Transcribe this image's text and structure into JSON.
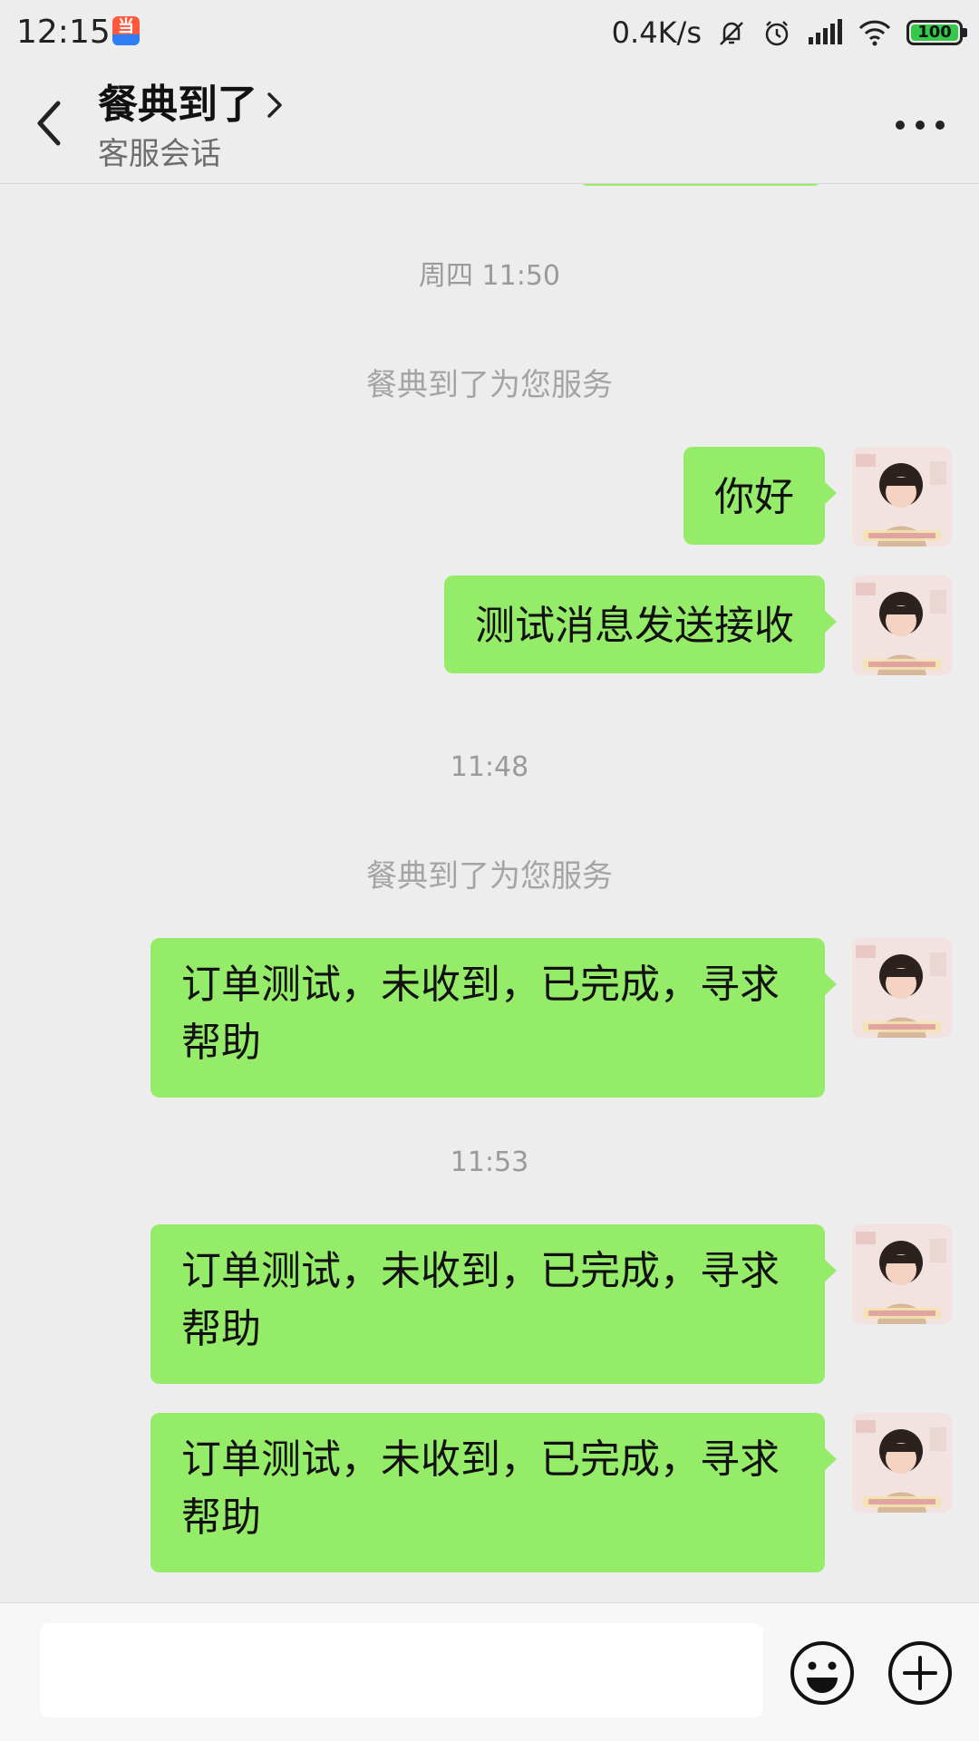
{
  "status_bar": {
    "time": "12:15",
    "network_speed": "0.4K/s",
    "battery_level": "100",
    "app_badge_icon": "app-notification-icon"
  },
  "header": {
    "title": "餐典到了",
    "subtitle": "客服会话"
  },
  "messages": [
    {
      "type": "timestamp",
      "text": "周四 11:50"
    },
    {
      "type": "system",
      "text": "餐典到了为您服务"
    },
    {
      "type": "sent",
      "text": "你好"
    },
    {
      "type": "sent",
      "text": "测试消息发送接收"
    },
    {
      "type": "timestamp",
      "text": "11:48"
    },
    {
      "type": "system",
      "text": "餐典到了为您服务"
    },
    {
      "type": "sent",
      "text": "订单测试，未收到，已完成，寻求帮助"
    },
    {
      "type": "timestamp",
      "text": "11:53"
    },
    {
      "type": "sent",
      "text": "订单测试，未收到，已完成，寻求帮助"
    },
    {
      "type": "sent",
      "text": "订单测试，未收到，已完成，寻求帮助"
    }
  ],
  "input": {
    "value": "",
    "placeholder": ""
  },
  "colors": {
    "background": "#ededed",
    "sent_bubble": "#95ec69",
    "timestamp_text": "#9a9a9a",
    "battery": "#34c94a"
  }
}
